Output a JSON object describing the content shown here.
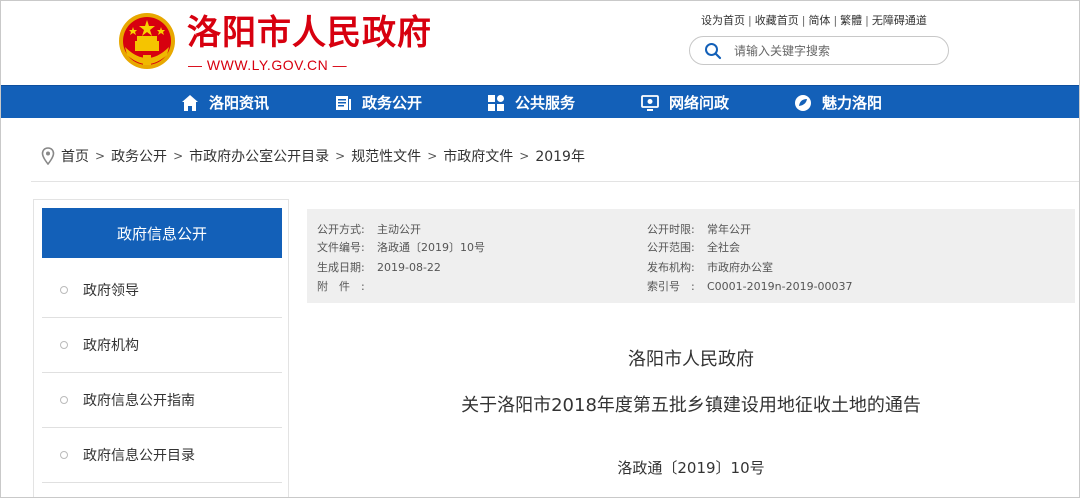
{
  "header": {
    "site_title": "洛阳市人民政府",
    "site_url": "— WWW.LY.GOV.CN —",
    "top_links": [
      "设为首页",
      "收藏首页",
      "简体",
      "繁體",
      "无障碍通道"
    ],
    "search_placeholder": "请输入关键字搜索",
    "brand_color": "#d7000f"
  },
  "nav": {
    "color": "#1360b8",
    "items": [
      {
        "label": "洛阳资讯",
        "icon": "home-icon"
      },
      {
        "label": "政务公开",
        "icon": "document-icon"
      },
      {
        "label": "公共服务",
        "icon": "grid-icon"
      },
      {
        "label": "网络问政",
        "icon": "monitor-icon"
      },
      {
        "label": "魅力洛阳",
        "icon": "leaf-icon"
      }
    ]
  },
  "breadcrumb": {
    "icon": "location-pin-icon",
    "items": [
      "首页",
      "政务公开",
      "市政府办公室公开目录",
      "规范性文件",
      "市政府文件",
      "2019年"
    ],
    "separator": ">"
  },
  "sidebar": {
    "heading": "政府信息公开",
    "items": [
      "政府领导",
      "政府机构",
      "政府信息公开指南",
      "政府信息公开目录"
    ]
  },
  "meta": {
    "left": [
      {
        "key": "公开方式:",
        "value": "主动公开"
      },
      {
        "key": "文件编号:",
        "value": "洛政通〔2019〕10号"
      },
      {
        "key": "生成日期:",
        "value": "2019-08-22"
      },
      {
        "key": "附　件　:",
        "value": ""
      }
    ],
    "right": [
      {
        "key": "公开时限:",
        "value": "常年公开"
      },
      {
        "key": "公开范围:",
        "value": "全社会"
      },
      {
        "key": "发布机构:",
        "value": "市政府办公室"
      },
      {
        "key": "索引号　:",
        "value": "C0001-2019n-2019-00037"
      }
    ]
  },
  "document": {
    "issuer": "洛阳市人民政府",
    "title": "关于洛阳市2018年度第五批乡镇建设用地征收土地的通告",
    "number": "洛政通〔2019〕10号"
  }
}
